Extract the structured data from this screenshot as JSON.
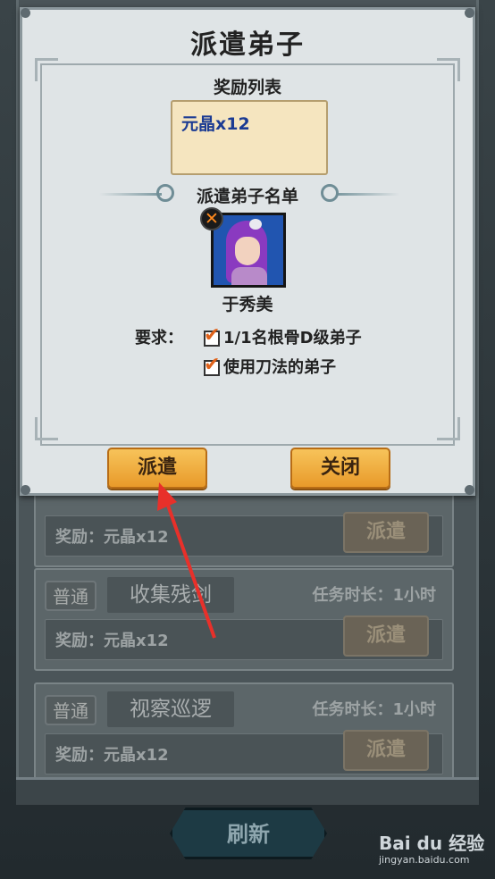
{
  "background": {
    "tasks": [
      {
        "badge": "",
        "name": "",
        "duration": "",
        "reward": "奖励：元晶x12",
        "dispatch": "派遣"
      },
      {
        "badge": "普通",
        "name": "收集残剑",
        "duration": "任务时长：1小时",
        "reward": "奖励：元晶x12",
        "dispatch": "派遣"
      },
      {
        "badge": "普通",
        "name": "视察巡逻",
        "duration": "任务时长：1小时",
        "reward": "奖励：元晶x12",
        "dispatch": "派遣"
      }
    ],
    "refresh_label": "刷新"
  },
  "dialog": {
    "title": "派遣弟子",
    "reward_heading": "奖励列表",
    "reward_item": "元晶x12",
    "disciple_heading": "派遣弟子名单",
    "disciple_name": "于秀美",
    "requirements_label": "要求：",
    "requirements": [
      "1/1名根骨D级弟子",
      "使用刀法的弟子"
    ],
    "dispatch_label": "派遣",
    "close_label": "关闭"
  },
  "watermark": {
    "brand": "Bai du 经验",
    "url": "jingyan.baidu.com"
  },
  "colors": {
    "accent_button": "#f2b145",
    "reward_text": "#1b3b93",
    "check": "#e0621a",
    "annotation_arrow": "#e8302a"
  },
  "icons": {
    "remove": "close-x-icon",
    "check": "checkmark-icon"
  }
}
